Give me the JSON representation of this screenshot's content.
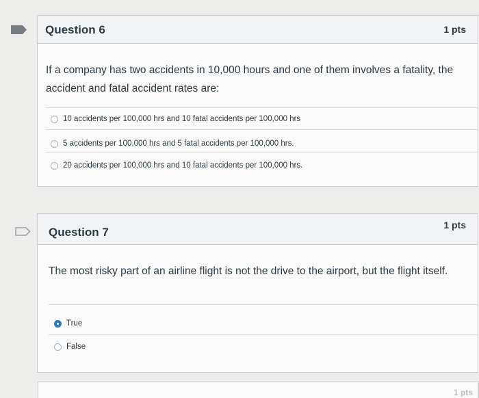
{
  "question6": {
    "title": "Question 6",
    "points": "1 pts",
    "text": "If a company has two accidents in 10,000 hours and one of them involves a fatality, the accident and fatal accident rates are:",
    "answers": [
      {
        "label": "10 accidents per 100,000 hrs and 10 fatal accidents per 100,000 hrs",
        "selected": false
      },
      {
        "label": "5 accidents per 100,000 hrs and 5 fatal accidents per 100,000 hrs.",
        "selected": false
      },
      {
        "label": "20 accidents per 100,000 hrs and 10 fatal accidents per 100,000 hrs.",
        "selected": false
      }
    ]
  },
  "question7": {
    "title": "Question 7",
    "points": "1 pts",
    "text": "The most risky part of an airline flight is not the drive to the airport, but the flight itself.",
    "answers": [
      {
        "label": "True",
        "selected": true
      },
      {
        "label": "False",
        "selected": false
      }
    ]
  },
  "question8": {
    "points": "1 pts"
  },
  "colors": {
    "flag_filled": "#777d82",
    "flag_outline": "#9aa0a5",
    "selected_radio": "#2b7abc",
    "text": "#2d3b45"
  },
  "icons": {
    "question6_flag": "bookmark-flag-filled-icon",
    "question7_flag": "bookmark-flag-outline-icon"
  }
}
